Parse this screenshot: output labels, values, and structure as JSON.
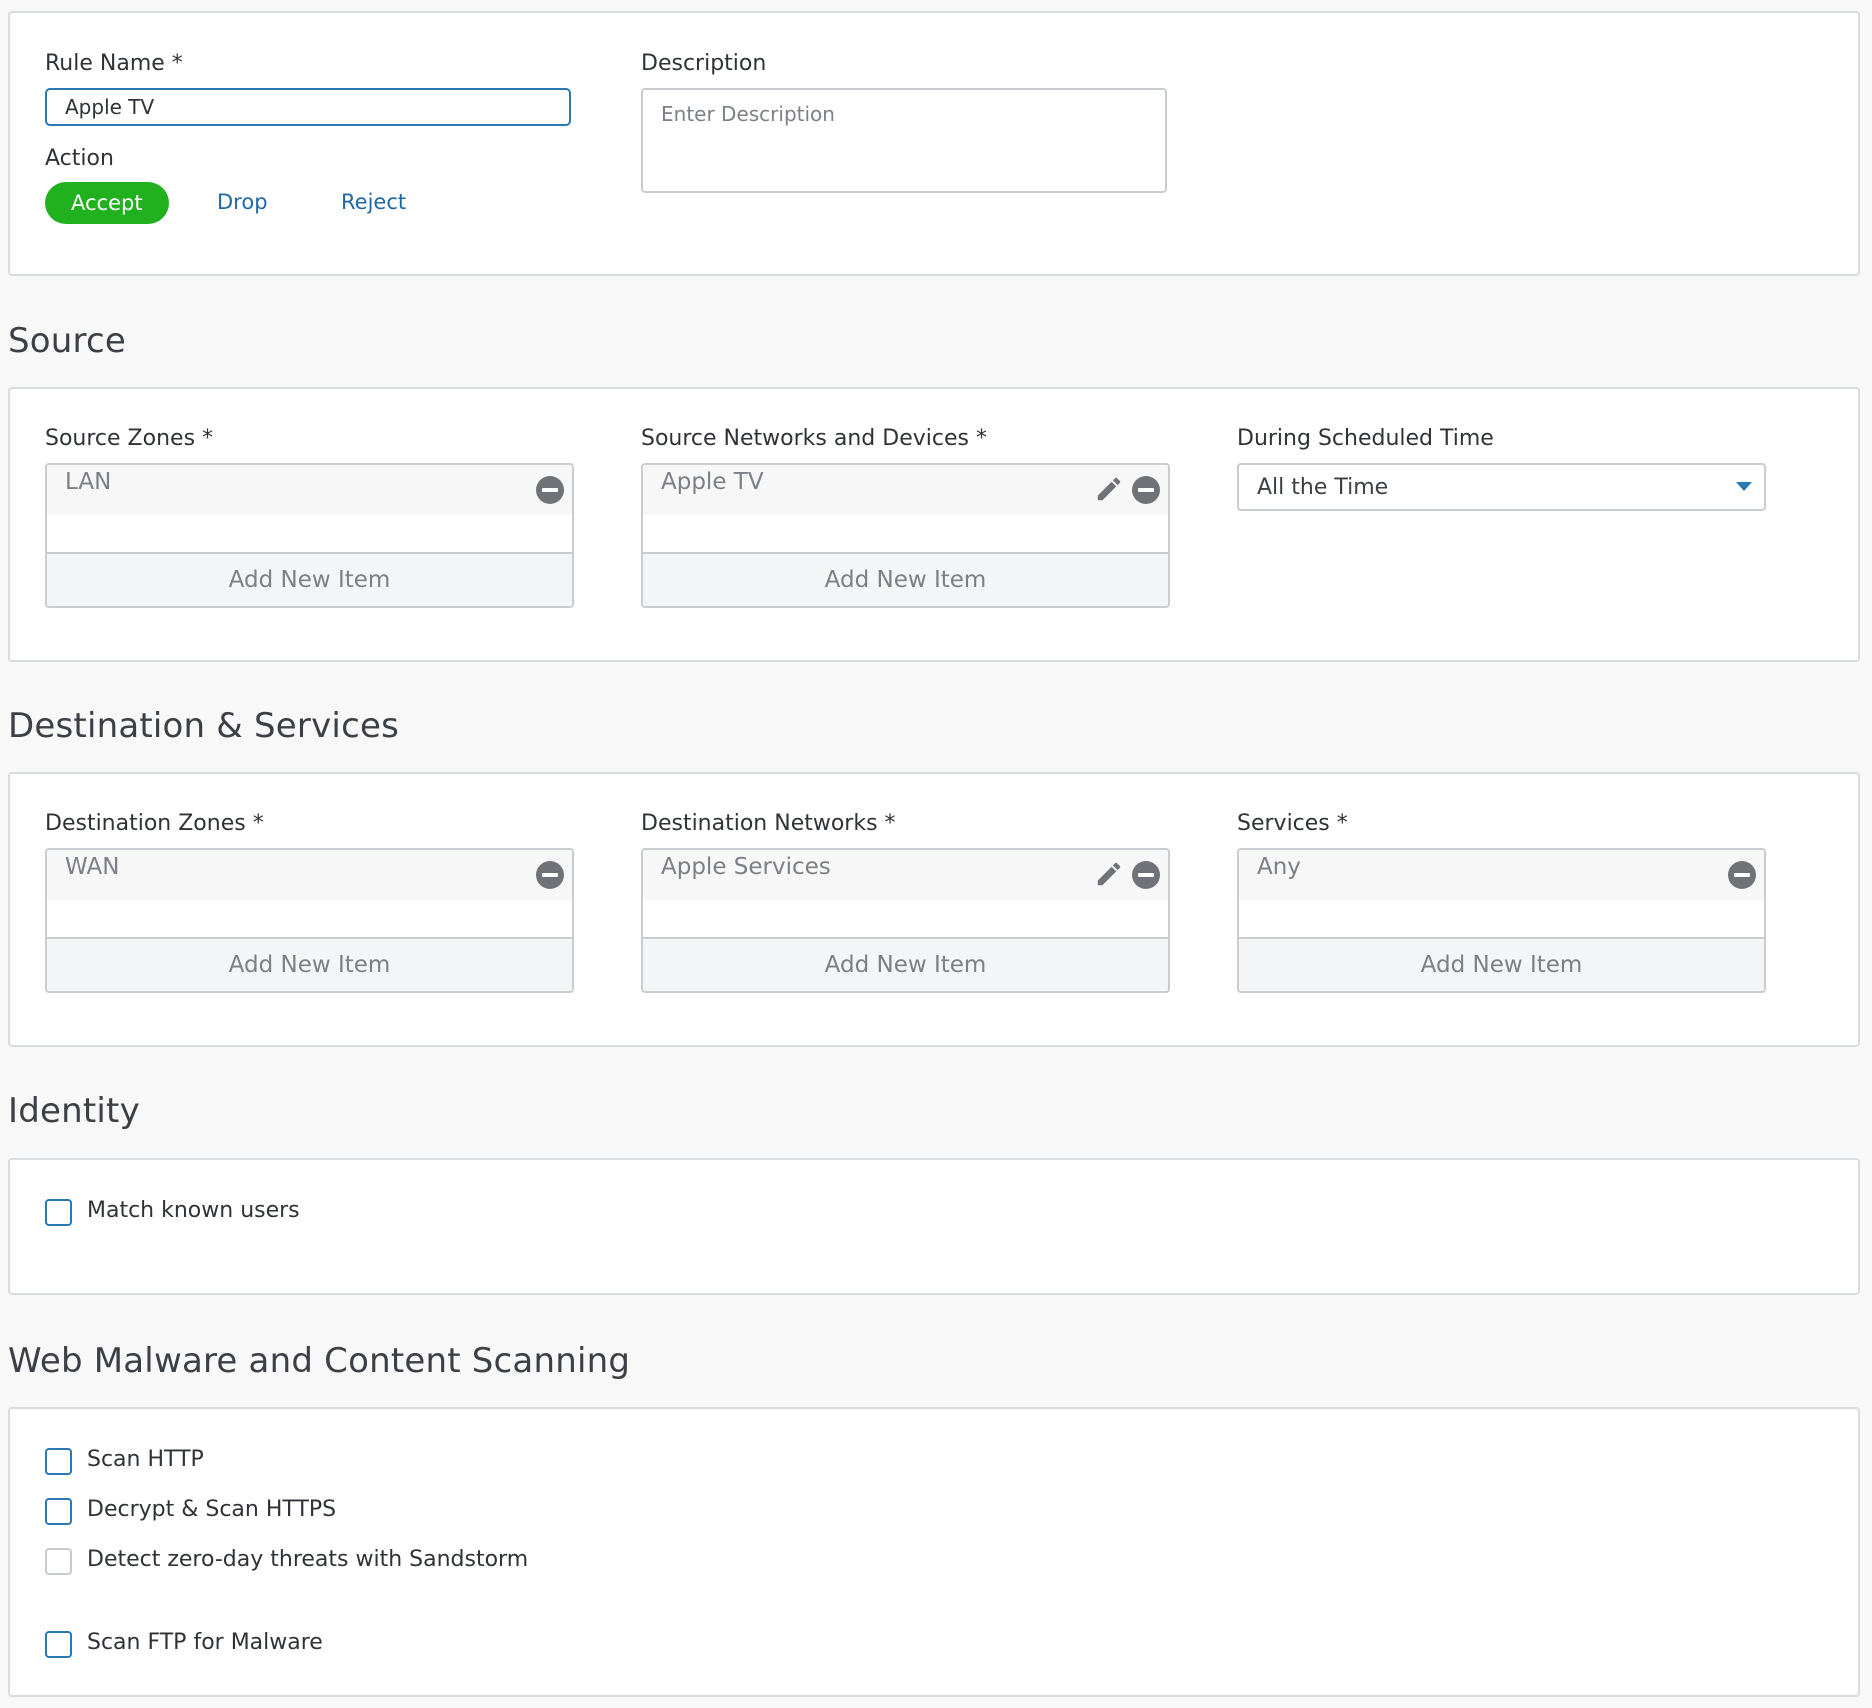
{
  "general": {
    "rule_name_label": "Rule Name *",
    "rule_name_value": "Apple TV",
    "description_label": "Description",
    "description_placeholder": "Enter Description",
    "action_label": "Action",
    "actions": [
      "Accept",
      "Drop",
      "Reject"
    ],
    "selected_action": "Accept"
  },
  "source": {
    "title": "Source",
    "zones_label": "Source Zones *",
    "zones_items": [
      "LAN"
    ],
    "networks_label": "Source Networks and Devices *",
    "networks_items": [
      "Apple TV"
    ],
    "schedule_label": "During Scheduled Time",
    "schedule_value": "All the Time",
    "add_new_item": "Add New Item"
  },
  "destination": {
    "title": "Destination & Services",
    "zones_label": "Destination Zones *",
    "zones_items": [
      "WAN"
    ],
    "networks_label": "Destination Networks *",
    "networks_items": [
      "Apple Services"
    ],
    "services_label": "Services *",
    "services_items": [
      "Any"
    ],
    "add_new_item": "Add New Item"
  },
  "identity": {
    "title": "Identity",
    "match_known_users": "Match known users",
    "match_known_users_checked": false
  },
  "web_malware": {
    "title": "Web Malware and Content Scanning",
    "scan_http": "Scan HTTP",
    "decrypt_https": "Decrypt & Scan HTTPS",
    "sandstorm": "Detect zero-day threats with Sandstorm",
    "scan_ftp": "Scan FTP for Malware"
  },
  "colors": {
    "accent": "#2b79b3",
    "accept_green": "#21b01e",
    "link_blue": "#2069a6",
    "icon_gray": "#6f7378"
  },
  "icons": {
    "remove": "minus-circle-icon",
    "edit": "pencil-icon",
    "dropdown": "caret-down-icon"
  }
}
